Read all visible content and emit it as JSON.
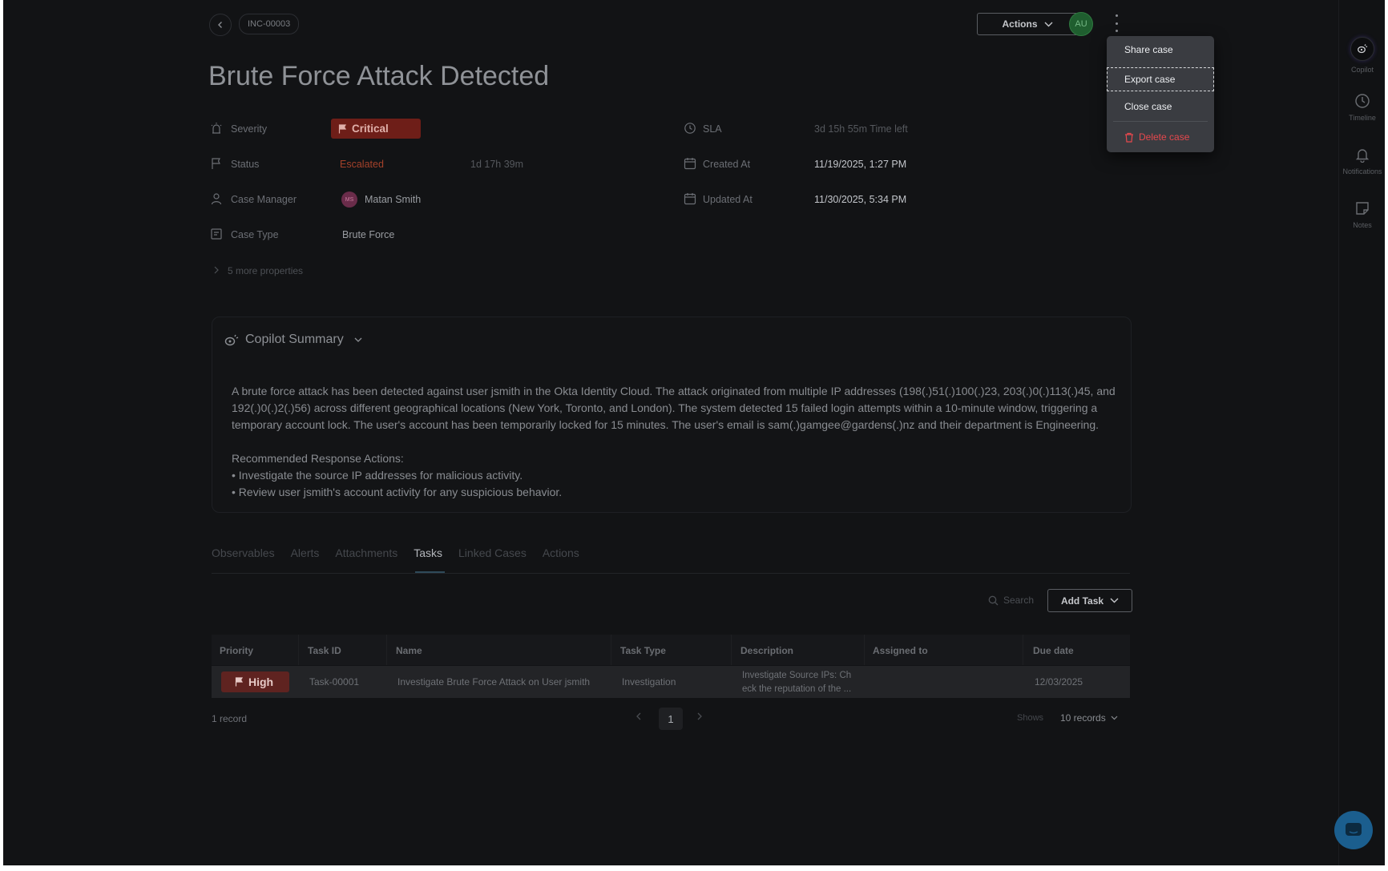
{
  "header": {
    "case_id": "INC-00003",
    "title": "Brute Force Attack Detected",
    "actions_label": "Actions",
    "avatar_initials": "AU"
  },
  "menu": {
    "items": [
      {
        "label": "Share case"
      },
      {
        "label": "Export case"
      },
      {
        "label": "Close case"
      },
      {
        "label": "Delete case"
      }
    ]
  },
  "properties": {
    "severity": {
      "label": "Severity",
      "value": "Critical"
    },
    "status": {
      "label": "Status",
      "value": "Escalated",
      "duration": "1d 17h 39m"
    },
    "case_manager": {
      "label": "Case Manager",
      "initials": "MS",
      "value": "Matan Smith"
    },
    "case_type": {
      "label": "Case Type",
      "value": "Brute Force"
    },
    "more": "5 more properties",
    "sla": {
      "label": "SLA",
      "value": "3d 15h 55m",
      "suffix": "Time left"
    },
    "created_at": {
      "label": "Created At",
      "value": "11/19/2025, 1:27 PM"
    },
    "updated_at": {
      "label": "Updated At",
      "value": "11/30/2025, 5:34 PM"
    }
  },
  "copilot": {
    "title": "Copilot Summary",
    "paragraph": "A brute force attack has been detected against user jsmith in the Okta Identity Cloud. The attack originated from multiple IP addresses (198(.)51(.)100(.)23, 203(.)0(.)113(.)45, and 192(.)0(.)2(.)56) across different geographical locations (New York, Toronto, and London). The system detected 15 failed login attempts within a 10-minute window, triggering a temporary account lock. The user's account has been temporarily locked for 15 minutes. The user's email is sam(.)gamgee@gardens(.)nz and their department is Engineering.",
    "actions_heading": "Recommended Response Actions:",
    "action_1": "• Investigate the source IP addresses for malicious activity.",
    "action_2": "• Review user jsmith's account activity for any suspicious behavior."
  },
  "tabs": [
    {
      "label": "Observables"
    },
    {
      "label": "Alerts"
    },
    {
      "label": "Attachments"
    },
    {
      "label": "Tasks"
    },
    {
      "label": "Linked Cases"
    },
    {
      "label": "Actions"
    }
  ],
  "toolbar": {
    "search_placeholder": "Search",
    "add_task_label": "Add Task"
  },
  "table": {
    "columns": [
      "Priority",
      "Task ID",
      "Name",
      "Task Type",
      "Description",
      "Assigned to",
      "Due date"
    ],
    "rows": [
      {
        "priority": "High",
        "task_id": "Task-00001",
        "name": "Investigate Brute Force Attack on User jsmith",
        "task_type": "Investigation",
        "description_line1": "Investigate Source IPs: Ch",
        "description_line2": "eck the reputation of the ...",
        "assigned_to": "",
        "due_date": "12/03/2025"
      }
    ]
  },
  "footer": {
    "record_count": "1 record",
    "current_page": "1",
    "shows_label": "Shows",
    "page_size": "10 records"
  },
  "rail": {
    "copilot": "Copilot",
    "timeline": "Timeline",
    "notifications": "Notifications",
    "notes": "Notes"
  },
  "colors": {
    "background": "#121315",
    "critical": "#6e1e18",
    "high": "#5f2320",
    "escalated": "#b8452a",
    "danger": "#e5484d",
    "avatar": "#1f5e2f",
    "chat_fab": "#1b5e8e"
  }
}
